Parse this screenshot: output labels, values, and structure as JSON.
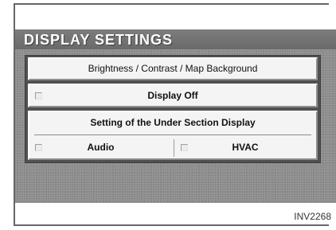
{
  "screen": {
    "title": "DISPLAY SETTINGS",
    "menu": {
      "brightness_label": "Brightness / Contrast / Map Background",
      "display_off_label": "Display Off",
      "display_off_checked": false,
      "under_section": {
        "label": "Setting of the Under Section Display",
        "options": [
          {
            "label": "Audio",
            "checked": false
          },
          {
            "label": "HVAC",
            "checked": false
          }
        ]
      }
    }
  },
  "figure_code": "INV2268",
  "colors": {
    "screen_background": "#8c8c8c",
    "title_text": "#ffffff",
    "button_face": "#f4f4f4",
    "panel_border": "#505050"
  }
}
